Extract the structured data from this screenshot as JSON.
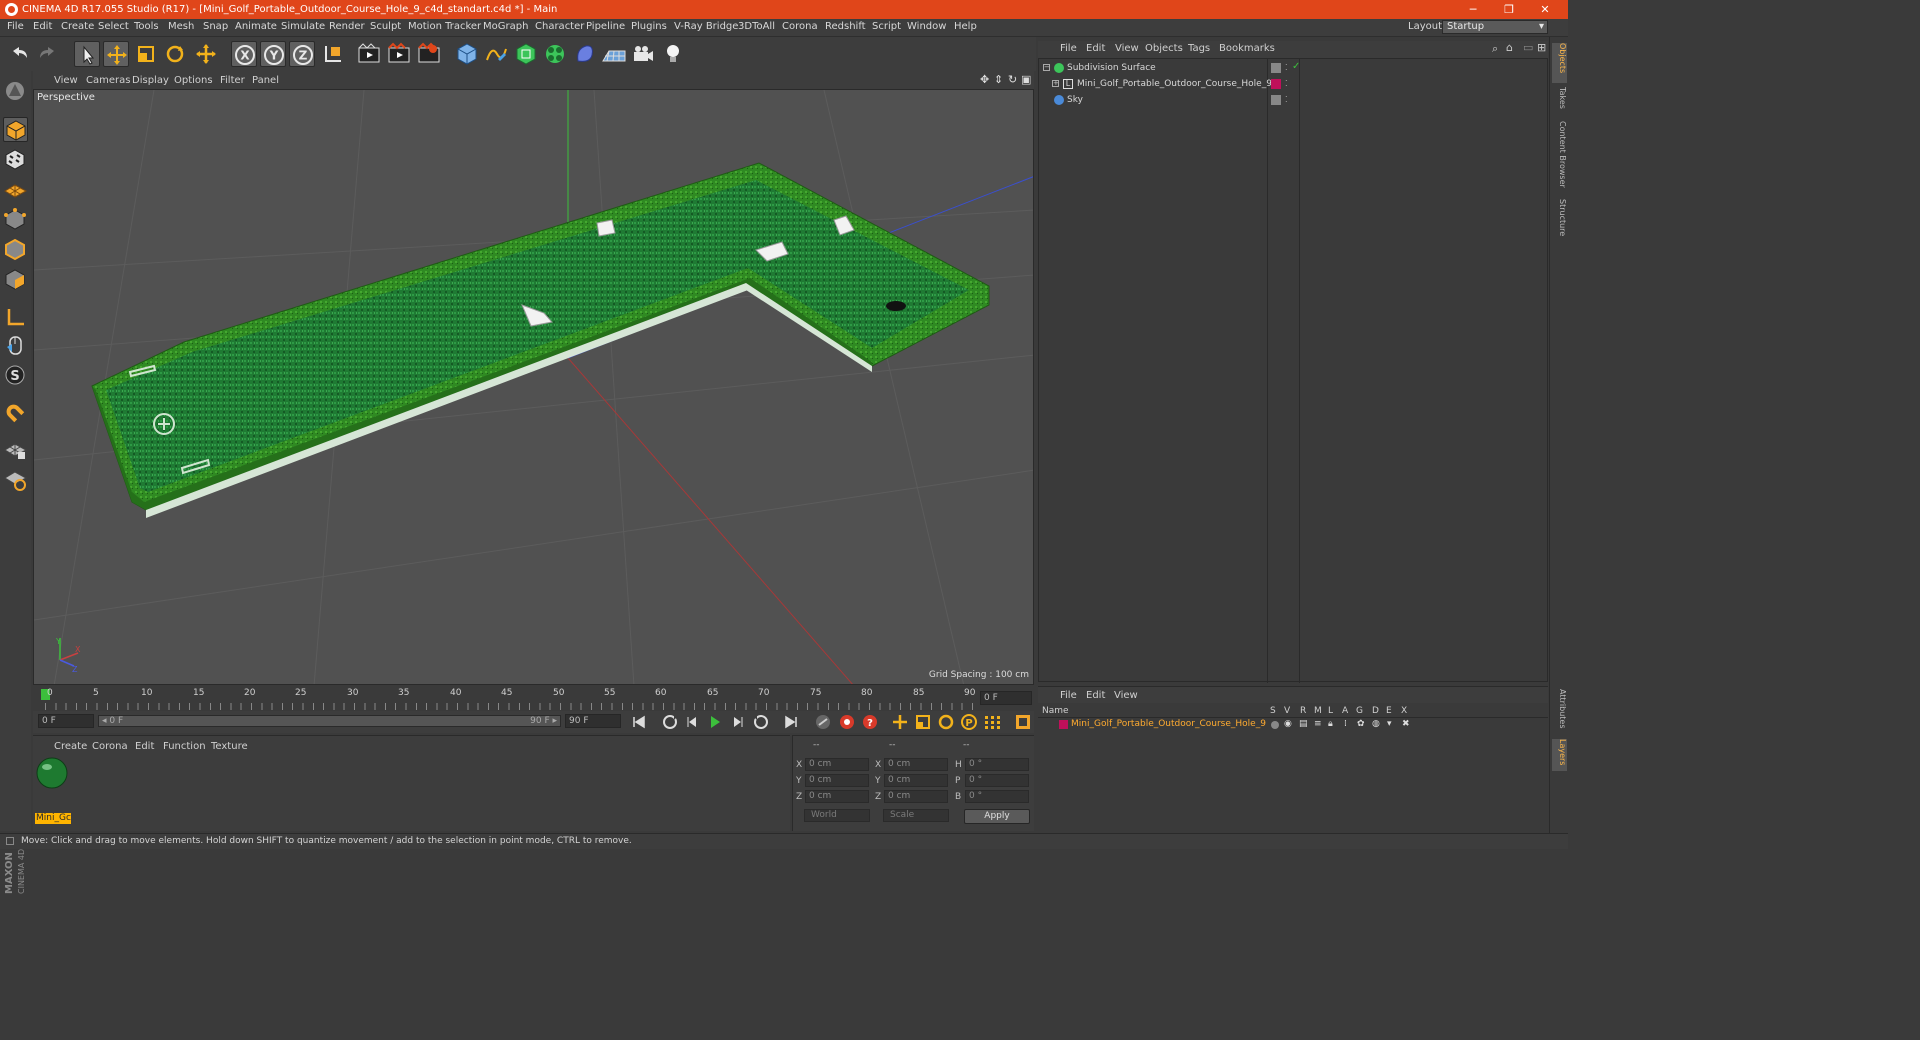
{
  "window": {
    "title": "CINEMA 4D R17.055 Studio (R17) - [Mini_Golf_Portable_Outdoor_Course_Hole_9_c4d_standart.c4d *] - Main",
    "controls": [
      "─",
      "❐",
      "✕"
    ]
  },
  "menubar": {
    "items": [
      "File",
      "Edit",
      "Create",
      "Select",
      "Tools",
      "Mesh",
      "Snap",
      "Animate",
      "Simulate",
      "Render",
      "Sculpt",
      "Motion Tracker",
      "MoGraph",
      "Character",
      "Pipeline",
      "Plugins",
      "V-Ray Bridge",
      "3DToAll",
      "Corona",
      "Redshift",
      "Script",
      "Window",
      "Help"
    ],
    "layout_label": "Layout:",
    "layout_value": "Startup"
  },
  "toolbar": {
    "axis_labels": [
      "X",
      "Y",
      "Z"
    ]
  },
  "viewport": {
    "menu": [
      "View",
      "Cameras",
      "Display",
      "Options",
      "Filter",
      "Panel"
    ],
    "label": "Perspective",
    "grid_spacing": "Grid Spacing : 100 cm",
    "axis_gizmo": [
      "Y",
      "X",
      "Z"
    ],
    "colors": {
      "green_axis": "#3cbf3c",
      "red_axis": "#b43a3a",
      "blue_axis": "#3a4fd0",
      "turf": "#1f7a33",
      "border": "#3a9a2a"
    }
  },
  "timeline": {
    "ticks": [
      "0",
      "5",
      "10",
      "15",
      "20",
      "25",
      "30",
      "35",
      "40",
      "45",
      "50",
      "55",
      "60",
      "65",
      "70",
      "75",
      "80",
      "85",
      "90"
    ],
    "current_frame_field": "0 F",
    "start_field": "0 F",
    "range_start": "◂ 0 F",
    "range_end": "90 F ▸",
    "end_field": "90 F"
  },
  "material_panel": {
    "menu": [
      "Create",
      "Corona",
      "Edit",
      "Function",
      "Texture"
    ],
    "material_name": "Mini_Gc"
  },
  "coord_panel": {
    "headers": [
      "--",
      "--",
      "--"
    ],
    "rows": [
      {
        "l1": "X",
        "v1": "0 cm",
        "l2": "X",
        "v2": "0 cm",
        "l3": "H",
        "v3": "0 °"
      },
      {
        "l1": "Y",
        "v1": "0 cm",
        "l2": "Y",
        "v2": "0 cm",
        "l3": "P",
        "v3": "0 °"
      },
      {
        "l1": "Z",
        "v1": "0 cm",
        "l2": "Z",
        "v2": "0 cm",
        "l3": "B",
        "v3": "0 °"
      }
    ],
    "space_select": "World",
    "mode_select": "Scale",
    "apply_label": "Apply"
  },
  "object_manager": {
    "menu": [
      "File",
      "Edit",
      "View",
      "Objects",
      "Tags",
      "Bookmarks"
    ],
    "objects": [
      {
        "name": "Subdivision Surface"
      },
      {
        "name": "Mini_Golf_Portable_Outdoor_Course_Hole_9"
      },
      {
        "name": "Sky"
      }
    ]
  },
  "side_tabs": [
    "Objects",
    "Takes",
    "Content Browser",
    "Structure"
  ],
  "side_tabs_lower": [
    "Attributes",
    "Layers"
  ],
  "layer_manager": {
    "menu": [
      "File",
      "Edit",
      "View"
    ],
    "columns": [
      "Name",
      "S",
      "V",
      "R",
      "M",
      "L",
      "A",
      "G",
      "D",
      "E",
      "X"
    ],
    "layer_name": "Mini_Golf_Portable_Outdoor_Course_Hole_9",
    "layer_color": "#c0105a"
  },
  "status": {
    "text": "Move: Click and drag to move elements. Hold down SHIFT to quantize movement / add to the selection in point mode, CTRL to remove."
  },
  "branding": {
    "maxon": "MAXON",
    "cinema": "CINEMA 4D"
  }
}
